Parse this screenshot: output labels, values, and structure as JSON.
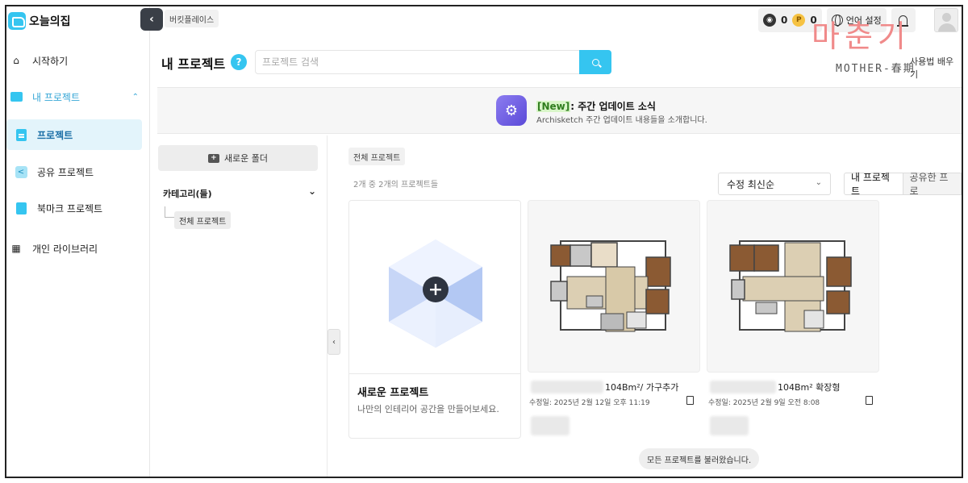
{
  "app": {
    "name": "오늘의집"
  },
  "header": {
    "marketplace": "버킷플레이스",
    "coin_dark": "0",
    "coin_gold": "0",
    "coin_gold_letter": "P",
    "language": "언어 설정",
    "help_link": "사용법 배우기"
  },
  "sidebar": {
    "items": [
      {
        "label": "시작하기"
      },
      {
        "label": "내 프로젝트"
      },
      {
        "label": "프로젝트"
      },
      {
        "label": "공유 프로젝트"
      },
      {
        "label": "북마크 프로젝트"
      },
      {
        "label": "개인 라이브러리"
      }
    ]
  },
  "main": {
    "title": "내 프로젝트",
    "help": "?",
    "search_placeholder": "프로젝트 검색"
  },
  "banner": {
    "tag": "[New]",
    "title": ": 주간 업데이트 소식",
    "subtitle": "Archisketch 주간 업데이트 내용들을 소개합니다."
  },
  "folders": {
    "new_folder": "새로운 폴더",
    "category": "카테고리(들)",
    "all_projects": "전체 프로젝트"
  },
  "projects": {
    "breadcrumb": "전체 프로젝트",
    "count": "2개 중 2개의 프로젝트들",
    "sort": "수정 최신순",
    "tabs": [
      "내 프로젝트",
      "공유한 프로"
    ],
    "new_card": {
      "title": "새로운 프로젝트",
      "subtitle": "나만의 인테리어 공간을 만들어보세요."
    },
    "items": [
      {
        "name": "104Bm²/ 가구추가",
        "date": "수정일: 2025년 2월 12일 오후 11:19"
      },
      {
        "name": "104Bm² 확장형",
        "name_prefix": "",
        "date": "수정일: 2025년 2월 9일 오전 8:08"
      }
    ],
    "toast": "모든 프로젝트를 불러왔습니다."
  },
  "watermark": {
    "main": "마춘기",
    "sub": "MOTHER-春期"
  }
}
